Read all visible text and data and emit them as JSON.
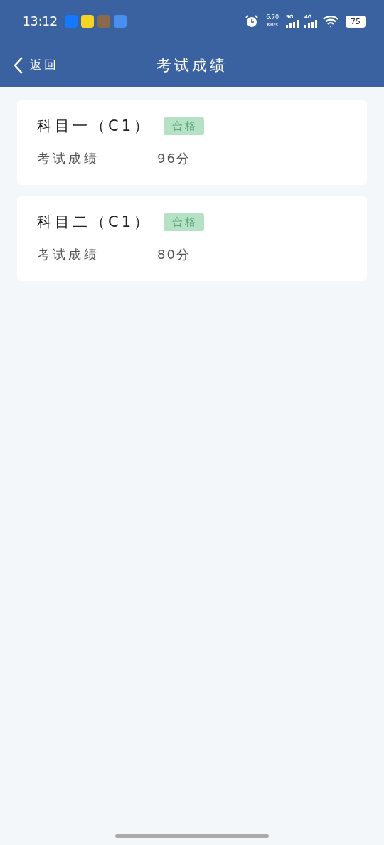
{
  "status_bar": {
    "time": "13:12",
    "speed": "6.70",
    "speed_unit": "KB/s",
    "sim_1": "5G",
    "sim_2": "4G",
    "battery": "75"
  },
  "header": {
    "back": "返回",
    "title": "考试成绩"
  },
  "results": [
    {
      "subject": "科目一（C1）",
      "badge": "合格",
      "passed": true,
      "label": "考试成绩",
      "score": "96分"
    },
    {
      "subject": "科目二（C1）",
      "badge": "合格",
      "passed": true,
      "label": "考试成绩",
      "score": "80分"
    }
  ]
}
